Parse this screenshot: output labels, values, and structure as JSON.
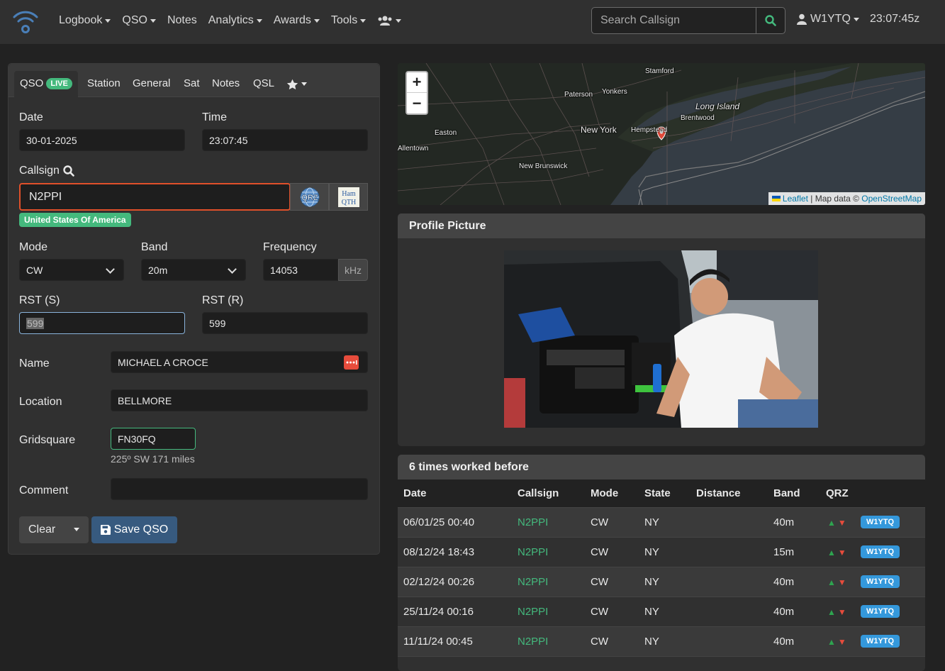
{
  "navbar": {
    "items": [
      "Logbook",
      "QSO",
      "Notes",
      "Analytics",
      "Awards",
      "Tools"
    ],
    "search_placeholder": "Search Callsign",
    "user": "W1YTQ",
    "clock": "23:07:45z"
  },
  "qso": {
    "tabs": [
      "QSO",
      "Station",
      "General",
      "Sat",
      "Notes",
      "QSL"
    ],
    "live_badge": "LIVE",
    "date_label": "Date",
    "date_value": "30-01-2025",
    "time_label": "Time",
    "time_value": "23:07:45",
    "callsign_label": "Callsign",
    "callsign_value": "N2PPI",
    "country": "United States Of America",
    "mode_label": "Mode",
    "mode_value": "CW",
    "band_label": "Band",
    "band_value": "20m",
    "freq_label": "Frequency",
    "freq_value": "14053",
    "freq_unit": "kHz",
    "rst_s_label": "RST (S)",
    "rst_s_value": "599",
    "rst_r_label": "RST (R)",
    "rst_r_value": "599",
    "name_label": "Name",
    "name_value": "MICHAEL A CROCE",
    "location_label": "Location",
    "location_value": "BELLMORE",
    "grid_label": "Gridsquare",
    "grid_value": "FN30FQ",
    "grid_info": "225º SW 171 miles",
    "comment_label": "Comment",
    "comment_value": "",
    "clear_label": "Clear",
    "save_label": "Save QSO"
  },
  "map": {
    "zoom_in": "+",
    "zoom_out": "−",
    "labels": [
      "Stamford",
      "Paterson",
      "Yonkers",
      "Long Island",
      "Brentwood",
      "New York",
      "Hempstead",
      "Easton",
      "Allentown",
      "New Brunswick"
    ],
    "attribution_leaflet": "Leaflet",
    "attribution_mid": "| Map data ©",
    "attribution_osm": "OpenStreetMap"
  },
  "profile": {
    "title": "Profile Picture"
  },
  "worked": {
    "title": "6 times worked before",
    "headers": [
      "Date",
      "Callsign",
      "Mode",
      "State",
      "Distance",
      "Band",
      "QRZ"
    ],
    "rows": [
      {
        "date": "06/01/25 00:40",
        "callsign": "N2PPI",
        "mode": "CW",
        "state": "NY",
        "distance": "",
        "band": "40m",
        "qrz": "W1YTQ"
      },
      {
        "date": "08/12/24 18:43",
        "callsign": "N2PPI",
        "mode": "CW",
        "state": "NY",
        "distance": "",
        "band": "15m",
        "qrz": "W1YTQ"
      },
      {
        "date": "02/12/24 00:26",
        "callsign": "N2PPI",
        "mode": "CW",
        "state": "NY",
        "distance": "",
        "band": "40m",
        "qrz": "W1YTQ"
      },
      {
        "date": "25/11/24 00:16",
        "callsign": "N2PPI",
        "mode": "CW",
        "state": "NY",
        "distance": "",
        "band": "40m",
        "qrz": "W1YTQ"
      },
      {
        "date": "11/11/24 00:45",
        "callsign": "N2PPI",
        "mode": "CW",
        "state": "NY",
        "distance": "",
        "band": "40m",
        "qrz": "W1YTQ"
      }
    ]
  },
  "colors": {
    "accent_green": "#44b97d",
    "primary_blue": "#375a7f",
    "badge_blue": "#3498db"
  }
}
